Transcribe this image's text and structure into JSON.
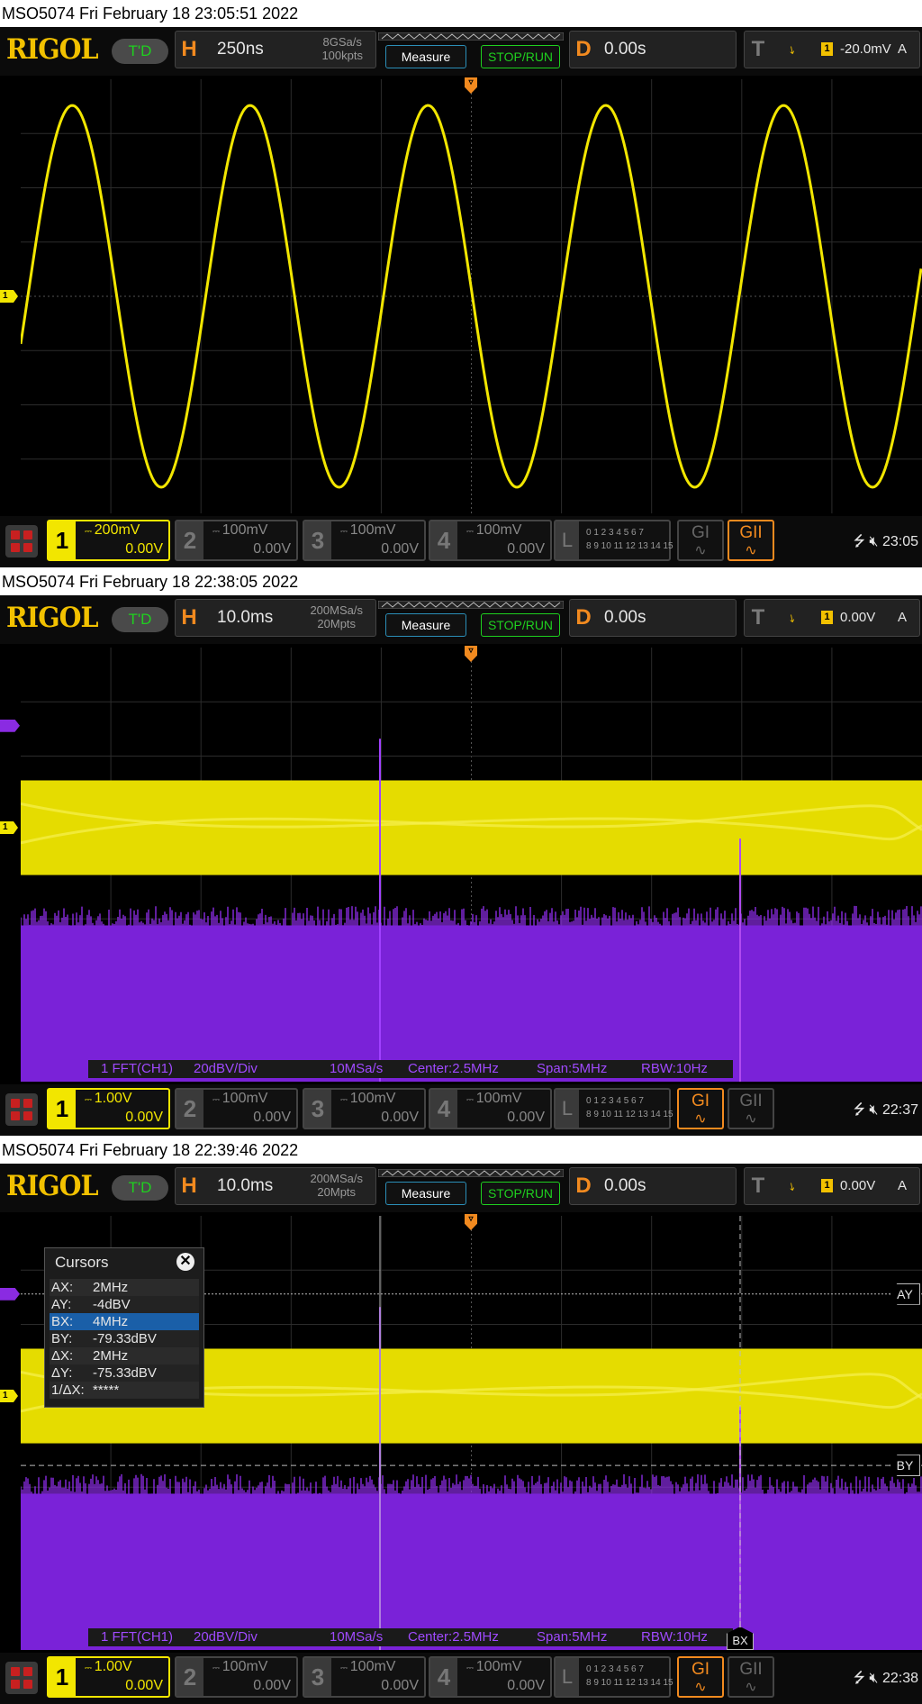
{
  "panels": [
    {
      "title": "MSO5074  Fri February 18 23:05:51 2022",
      "logo": "RIGOL",
      "td": "T'D",
      "h_letter": "H",
      "timebase": "250ns",
      "srate_top": "8GSa/s",
      "srate_bottom": "100kpts",
      "measure": "Measure",
      "stoprun": "STOP/RUN",
      "d_letter": "D",
      "delay": "0.00s",
      "t_letter": "T",
      "trig_ch": "1",
      "trig_level": "-20.0mV",
      "trig_mode": "A",
      "ch1_scale": "200mV",
      "ch1_offset": "0.00V",
      "ch2_scale": "100mV",
      "ch2_offset": "0.00V",
      "ch3_scale": "100mV",
      "ch3_offset": "0.00V",
      "ch4_scale": "100mV",
      "ch4_offset": "0.00V",
      "time": "23:05"
    },
    {
      "title": "MSO5074  Fri February 18 22:38:05 2022",
      "logo": "RIGOL",
      "td": "T'D",
      "h_letter": "H",
      "timebase": "10.0ms",
      "srate_top": "200MSa/s",
      "srate_bottom": "20Mpts",
      "measure": "Measure",
      "stoprun": "STOP/RUN",
      "d_letter": "D",
      "delay": "0.00s",
      "t_letter": "T",
      "trig_ch": "1",
      "trig_level": "0.00V",
      "trig_mode": "A",
      "ch1_scale": "1.00V",
      "ch1_offset": "0.00V",
      "ch2_scale": "100mV",
      "ch2_offset": "0.00V",
      "ch3_scale": "100mV",
      "ch3_offset": "0.00V",
      "ch4_scale": "100mV",
      "ch4_offset": "0.00V",
      "time": "22:37"
    },
    {
      "title": "MSO5074  Fri February 18 22:39:46 2022",
      "logo": "RIGOL",
      "td": "T'D",
      "h_letter": "H",
      "timebase": "10.0ms",
      "srate_top": "200MSa/s",
      "srate_bottom": "20Mpts",
      "measure": "Measure",
      "stoprun": "STOP/RUN",
      "d_letter": "D",
      "delay": "0.00s",
      "t_letter": "T",
      "trig_ch": "1",
      "trig_level": "0.00V",
      "trig_mode": "A",
      "ch1_scale": "1.00V",
      "ch1_offset": "0.00V",
      "ch2_scale": "100mV",
      "ch2_offset": "0.00V",
      "ch3_scale": "100mV",
      "ch3_offset": "0.00V",
      "ch4_scale": "100mV",
      "ch4_offset": "0.00V",
      "time": "22:38"
    }
  ],
  "fft": {
    "label": "1 FFT(CH1)",
    "scale": "20dBV/Div",
    "rate": "10MSa/s",
    "center": "Center:2.5MHz",
    "span": "Span:5MHz",
    "rbw": "RBW:10Hz"
  },
  "channel_labels": {
    "ch1": "1",
    "ch2": "2",
    "ch3": "3",
    "ch4": "4",
    "la": "L"
  },
  "la_row1": "0 1 2 3  4 5 6 7",
  "la_row2": "8  9 10 11 12 13 14 15",
  "gen1": "GI",
  "gen2": "GII",
  "cursors": {
    "title": "Cursors",
    "close": "✕",
    "rows": [
      {
        "k": "AX:",
        "v": "2MHz"
      },
      {
        "k": "AY:",
        "v": "-4dBV"
      },
      {
        "k": "BX:",
        "v": "4MHz"
      },
      {
        "k": "BY:",
        "v": "-79.33dBV"
      },
      {
        "k": "ΔX:",
        "v": "2MHz"
      },
      {
        "k": "ΔY:",
        "v": "-75.33dBV"
      },
      {
        "k": "1/ΔX:",
        "v": "*****"
      }
    ],
    "ay_tag": "AY",
    "by_tag": "BY",
    "bx_tag": "BX"
  },
  "colors": {
    "ch1": "#f2e600",
    "fft": "#8a2be2",
    "accent": "#f28a1f",
    "logo": "#f2c100",
    "run": "#1fd01f"
  },
  "icons": [
    "usb-icon",
    "speaker-muted-icon",
    "app-menu-icon",
    "trigger-rising-edge-icon"
  ]
}
